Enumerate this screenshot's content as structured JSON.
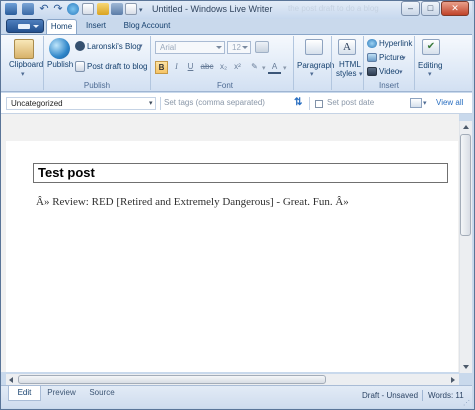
{
  "window": {
    "title": "Untitled - Windows Live Writer",
    "ghost_title": "the post draft to do a blog"
  },
  "ribbon_tabs": [
    "Home",
    "Insert",
    "Blog Account"
  ],
  "ribbon": {
    "clipboard": {
      "label": "Clipboard"
    },
    "publish": {
      "publish_label": "Publish",
      "blog_name": "Laronski's Blog",
      "post_draft_label": "Post draft to blog",
      "group_label": "Publish"
    },
    "font": {
      "family_placeholder": "Arial",
      "size_placeholder": "12",
      "group_label": "Font",
      "bold": "B",
      "italic": "I",
      "underline": "U",
      "strike": "abc",
      "subscript": "x₂",
      "superscript": "x²",
      "highlight": "✎",
      "color": "A"
    },
    "paragraph": {
      "label": "Paragraph"
    },
    "html_styles": {
      "label_line1": "HTML",
      "label_line2": "styles"
    },
    "insert": {
      "hyperlink": "Hyperlink",
      "picture": "Picture",
      "video": "Video",
      "group_label": "Insert"
    },
    "editing": {
      "label": "Editing"
    }
  },
  "meta": {
    "category": "Uncategorized",
    "tags_placeholder": "Set tags (comma separated)",
    "post_date_label": "Set post date",
    "view_all": "View all"
  },
  "editor": {
    "title": "Test post",
    "body": "Â» Review: RED [Retired and Extremely Dangerous] - Great. Fun. Â»"
  },
  "view_tabs": [
    "Edit",
    "Preview",
    "Source"
  ],
  "status": {
    "state": "Draft - Unsaved",
    "words_label": "Words: 11"
  },
  "colors": {
    "ribbon_bg": "#dde8f6",
    "frame": "#c9d9ec",
    "accent_text": "#15406e",
    "highlight_button": "#f6c465"
  }
}
